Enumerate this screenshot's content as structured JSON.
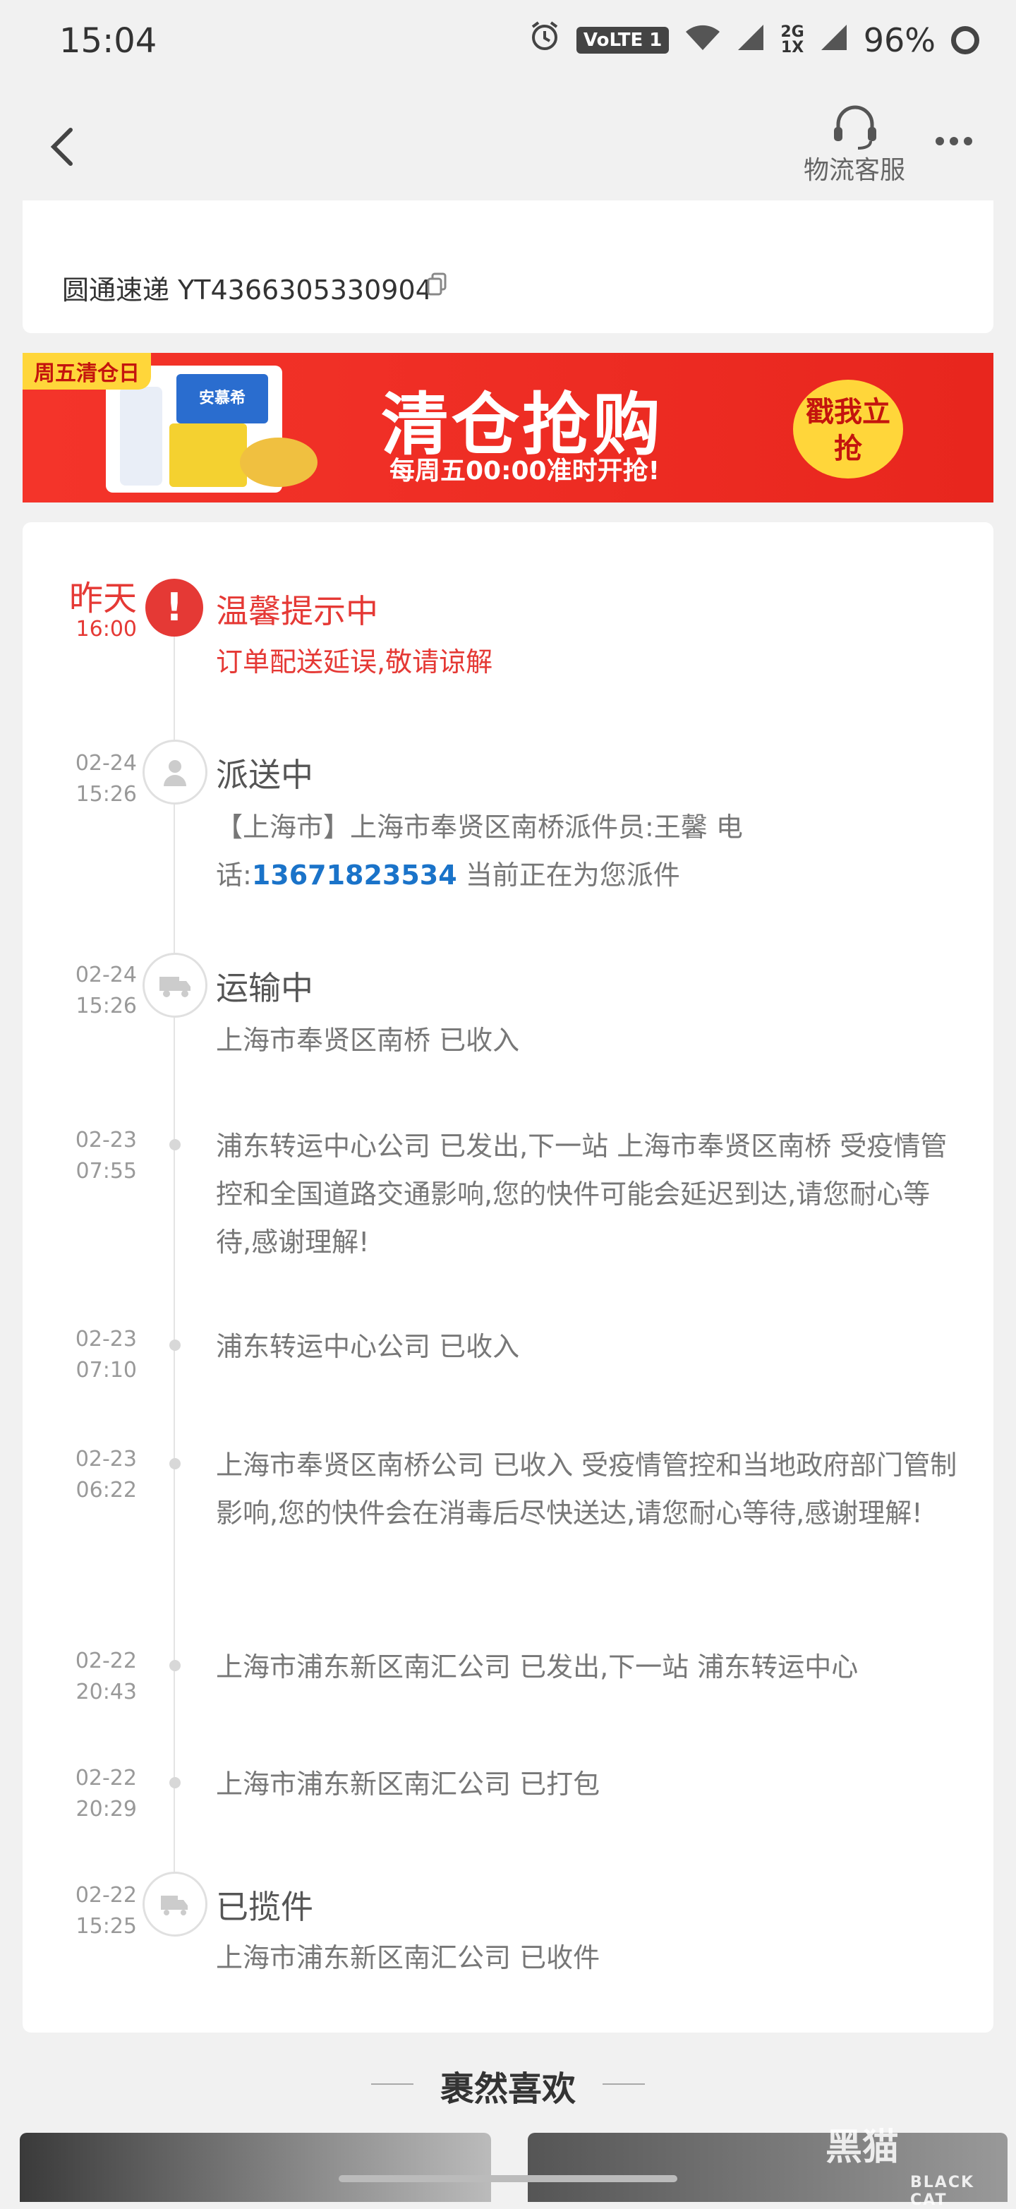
{
  "status_bar": {
    "time": "15:04",
    "volte": "VoLTE 1",
    "net_top": "2G",
    "net_bottom": "1X",
    "battery": "96%"
  },
  "header": {
    "customer_service_label": "物流客服"
  },
  "tracking": {
    "text": "圆通速递 YT4366305330904"
  },
  "banner": {
    "tag": "周五清仓日",
    "product_brand": "安慕希",
    "title": "清仓抢购",
    "subtitle": "每周五00:00准时开抢!",
    "button": "戳我立抢"
  },
  "timeline": [
    {
      "date_main": "昨天",
      "time": "16:00",
      "title": "温馨提示中",
      "desc": "订单配送延误,敬请谅解"
    },
    {
      "date": "02-24",
      "time": "15:26",
      "title": "派送中",
      "desc_before": "【上海市】上海市奉贤区南桥派件员:王馨 电话:",
      "phone": "13671823534",
      "desc_after": " 当前正在为您派件"
    },
    {
      "date": "02-24",
      "time": "15:26",
      "title": "运输中",
      "desc": "上海市奉贤区南桥 已收入"
    },
    {
      "date": "02-23",
      "time": "07:55",
      "desc": "浦东转运中心公司 已发出,下一站 上海市奉贤区南桥 受疫情管控和全国道路交通影响,您的快件可能会延迟到达,请您耐心等待,感谢理解!"
    },
    {
      "date": "02-23",
      "time": "07:10",
      "desc": "浦东转运中心公司 已收入"
    },
    {
      "date": "02-23",
      "time": "06:22",
      "desc": "上海市奉贤区南桥公司 已收入 受疫情管控和当地政府部门管制影响,您的快件会在消毒后尽快送达,请您耐心等待,感谢理解!"
    },
    {
      "date": "02-22",
      "time": "20:43",
      "desc": "上海市浦东新区南汇公司 已发出,下一站 浦东转运中心"
    },
    {
      "date": "02-22",
      "time": "20:29",
      "desc": "上海市浦东新区南汇公司 已打包"
    },
    {
      "date": "02-22",
      "time": "15:25",
      "title": "已揽件",
      "desc": "上海市浦东新区南汇公司 已收件"
    }
  ],
  "recommendations": {
    "title": "裹然喜欢"
  },
  "watermark": {
    "main": "黑猫",
    "sub": "BLACK CAT"
  },
  "colors": {
    "accent_red": "#e53935",
    "link_blue": "#1a73c9",
    "banner_red": "#f4342a"
  }
}
